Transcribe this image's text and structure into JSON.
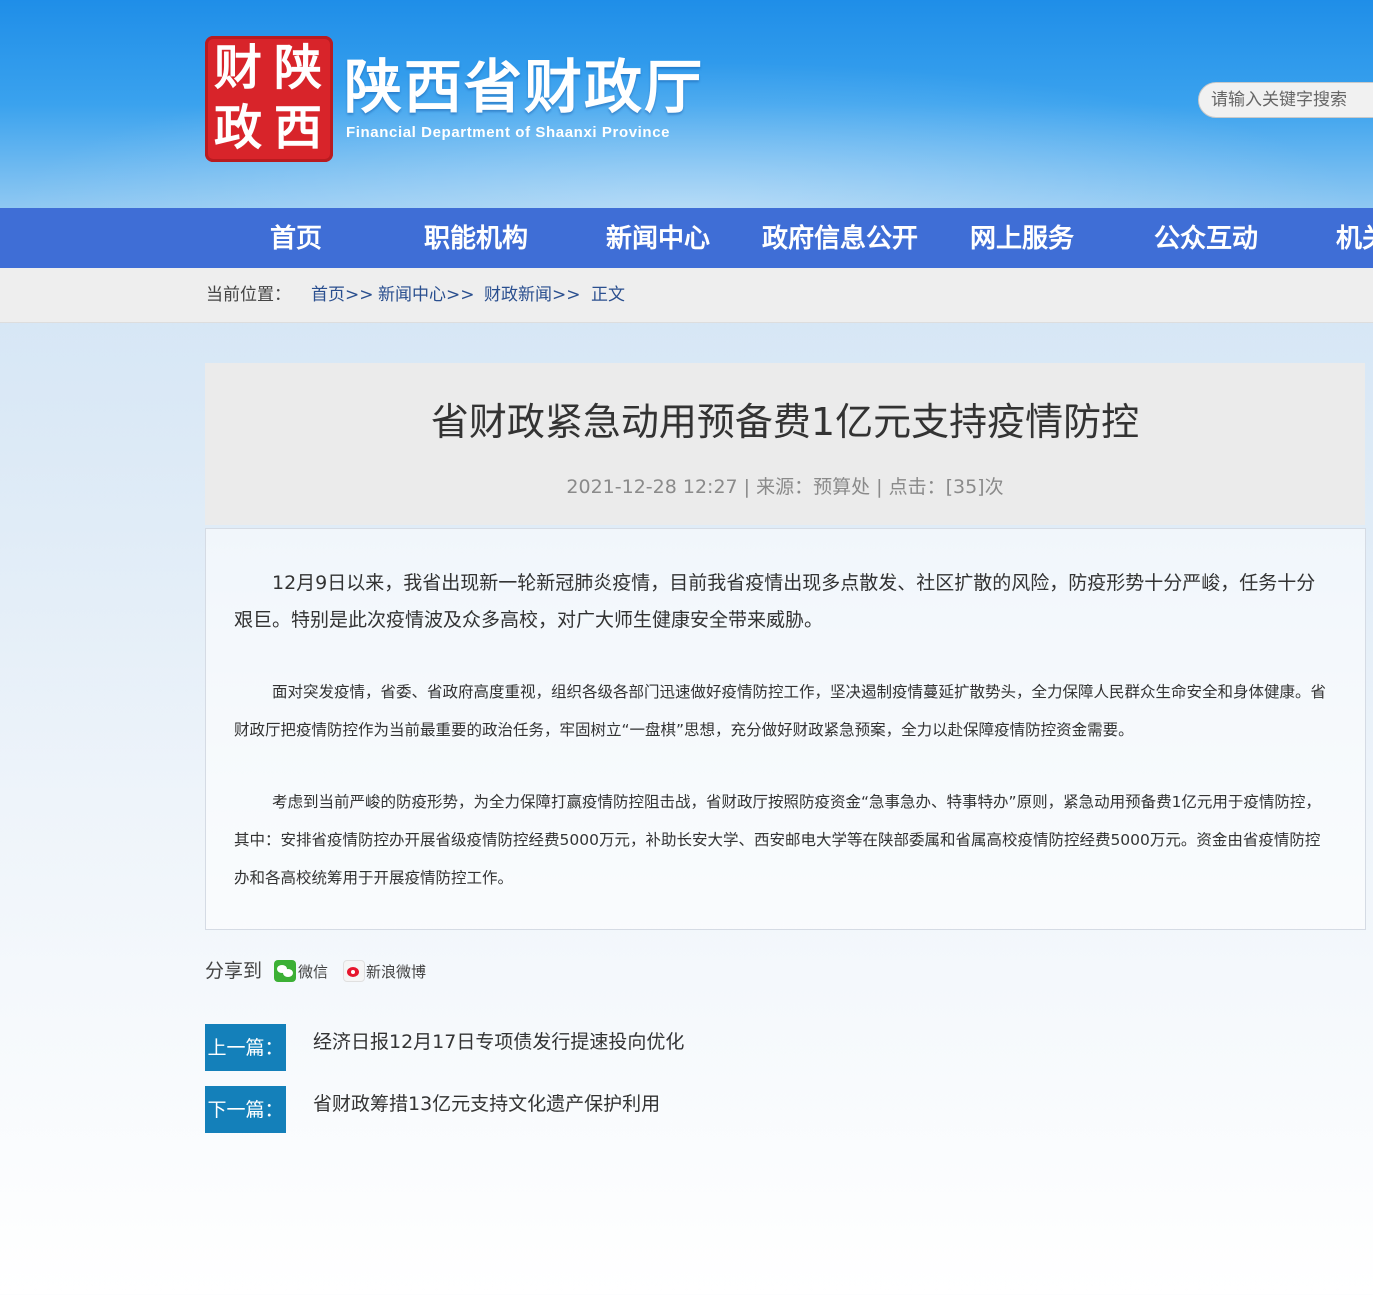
{
  "header": {
    "logo_chars": [
      "财",
      "陕",
      "政",
      "西"
    ],
    "site_name": "陕西省财政厅",
    "site_name_en": "Financial Department of Shaanxi Province",
    "search_placeholder": "请输入关键字搜索"
  },
  "nav": {
    "items": [
      "首页",
      "职能机构",
      "新闻中心",
      "政府信息公开",
      "网上服务",
      "公众互动",
      "机关"
    ]
  },
  "breadcrumb": {
    "label": "当前位置：",
    "items": [
      "首页>>",
      "新闻中心>>",
      "财政新闻>>",
      "正文"
    ]
  },
  "article": {
    "title": "省财政紧急动用预备费1亿元支持疫情防控",
    "meta": "2021-12-28 12:27 | 来源：预算处 | 点击：[35]次",
    "paragraphs": [
      "12月9日以来，我省出现新一轮新冠肺炎疫情，目前我省疫情出现多点散发、社区扩散的风险，防疫形势十分严峻，任务十分艰巨。特别是此次疫情波及众多高校，对广大师生健康安全带来威胁。",
      "面对突发疫情，省委、省政府高度重视，组织各级各部门迅速做好疫情防控工作，坚决遏制疫情蔓延扩散势头，全力保障人民群众生命安全和身体健康。省财政厅把疫情防控作为当前最重要的政治任务，牢固树立“一盘棋”思想，充分做好财政紧急预案，全力以赴保障疫情防控资金需要。",
      "考虑到当前严峻的防疫形势，为全力保障打赢疫情防控阻击战，省财政厅按照防疫资金“急事急办、特事特办”原则，紧急动用预备费1亿元用于疫情防控，其中：安排省疫情防控办开展省级疫情防控经费5000万元，补助长安大学、西安邮电大学等在陕部委属和省属高校疫情防控经费5000万元。资金由省疫情防控办和各高校统筹用于开展疫情防控工作。"
    ]
  },
  "share": {
    "label": "分享到",
    "wechat": "微信",
    "weibo": "新浪微博"
  },
  "pager": {
    "prev_label": "上一篇：",
    "prev_title": "经济日报12月17日专项债发行提速投向优化",
    "next_label": "下一篇：",
    "next_title": "省财政筹措13亿元支持文化遗产保护利用"
  }
}
